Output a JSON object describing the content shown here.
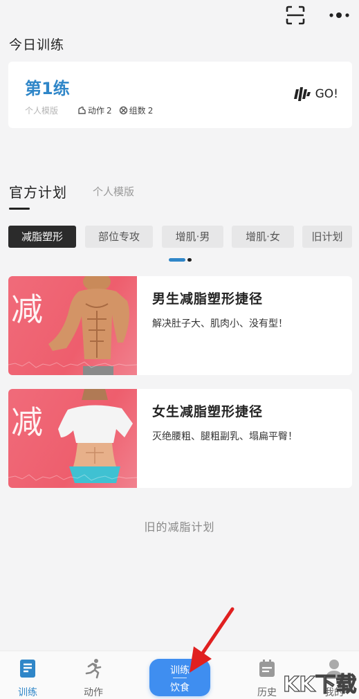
{
  "header": {
    "icons": [
      "scan-icon",
      "more-icon"
    ]
  },
  "today": {
    "section_title": "今日训练",
    "card": {
      "name": "第1练",
      "template_label": "个人模版",
      "actions_label": "动作",
      "actions_count": "2",
      "groups_label": "组数",
      "groups_count": "2",
      "go_label": "GO!"
    }
  },
  "plans": {
    "tabs": [
      {
        "label": "官方计划",
        "active": true
      },
      {
        "label": "个人模版",
        "active": false
      }
    ],
    "categories": [
      {
        "label": "减脂塑形",
        "active": true
      },
      {
        "label": "部位专攻",
        "active": false
      },
      {
        "label": "增肌·男",
        "active": false
      },
      {
        "label": "增肌·女",
        "active": false
      },
      {
        "label": "旧计划",
        "active": false
      }
    ],
    "items": [
      {
        "thumb_char": "减",
        "title": "男生减脂塑形捷径",
        "desc": "解决肚子大、肌肉小、没有型！"
      },
      {
        "thumb_char": "减",
        "title": "女生减脂塑形捷径",
        "desc": "灭绝腰粗、腿粗副乳、塌扁平臀！"
      }
    ],
    "old_plans_link": "旧的减脂计划"
  },
  "bottom_nav": {
    "items": [
      {
        "label": "训练",
        "active": true,
        "icon": "training-icon"
      },
      {
        "label": "动作",
        "active": false,
        "icon": "running-icon"
      },
      {
        "label": "历史",
        "active": false,
        "icon": "calendar-icon"
      },
      {
        "label": "我的",
        "active": false,
        "icon": "profile-icon"
      }
    ],
    "center": {
      "line1": "训练",
      "line2": "饮食"
    }
  },
  "watermark": "KK下载",
  "colors": {
    "accent": "#2f86c8",
    "center_button": "#3f8ef0",
    "thumb_pink": "#ee5e6d",
    "arrow_red": "#e02020"
  }
}
